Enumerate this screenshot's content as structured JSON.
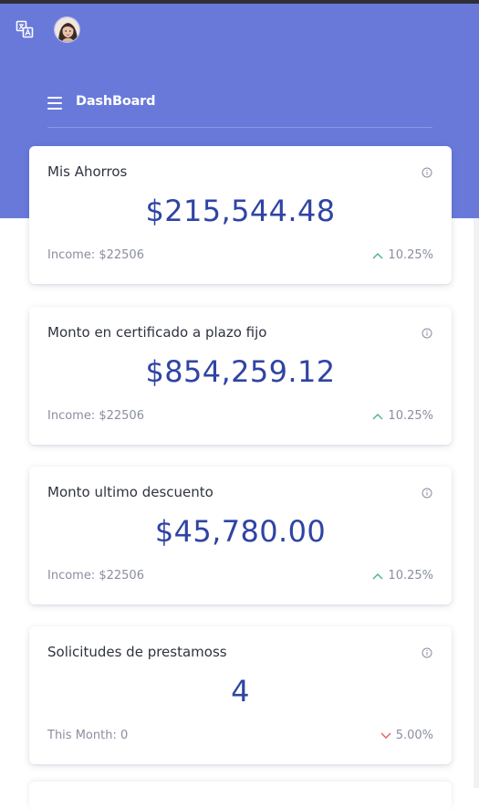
{
  "header": {
    "title": "DashBoard"
  },
  "cards": [
    {
      "title": "Mis Ahorros",
      "value": "$215,544.48",
      "sub": "Income: $22506",
      "change": "10.25%",
      "trend": "up"
    },
    {
      "title": "Monto en certificado a plazo fijo",
      "value": "$854,259.12",
      "sub": "Income: $22506",
      "change": "10.25%",
      "trend": "up"
    },
    {
      "title": "Monto ultimo descuento",
      "value": "$45,780.00",
      "sub": "Income: $22506",
      "change": "10.25%",
      "trend": "up"
    },
    {
      "title": "Solicitudes de prestamoss",
      "value": "4",
      "sub": "This Month: 0",
      "change": "5.00%",
      "trend": "down"
    }
  ],
  "icons": {
    "translate": "translate-icon",
    "avatar": "user-avatar",
    "menu": "hamburger-menu-icon",
    "info": "info-icon",
    "up": "chevron-up-icon",
    "down": "chevron-down-icon"
  },
  "colors": {
    "header_bg": "#6879da",
    "value_text": "#2f44a3",
    "trend_up": "#4caf9a",
    "trend_down": "#e35d5d"
  }
}
